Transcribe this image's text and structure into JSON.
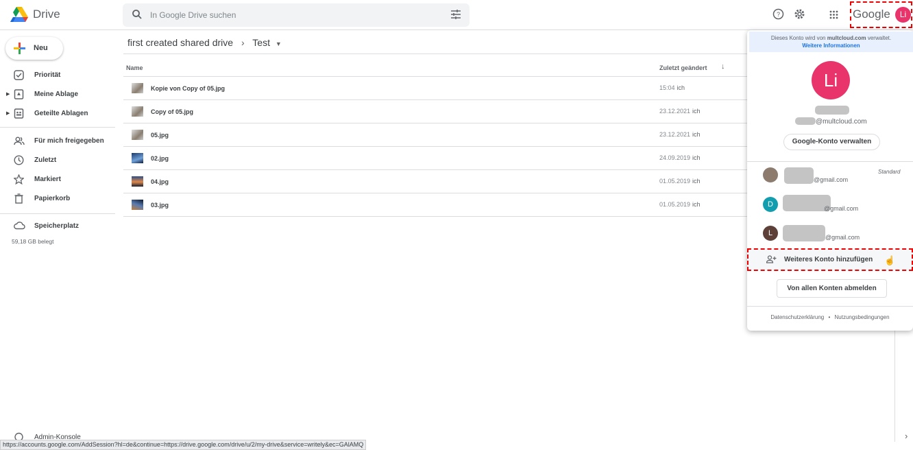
{
  "header": {
    "app_name": "Drive",
    "search_placeholder": "In Google Drive suchen",
    "google_logo": "Google",
    "avatar_initials": "Li"
  },
  "sidebar": {
    "new_label": "Neu",
    "items": [
      {
        "label": "Priorität",
        "icon": "check-box-icon"
      },
      {
        "label": "Meine Ablage",
        "icon": "my-drive-icon"
      },
      {
        "label": "Geteilte Ablagen",
        "icon": "shared-drives-icon"
      },
      {
        "label": "Für mich freigegeben",
        "icon": "people-icon"
      },
      {
        "label": "Zuletzt",
        "icon": "clock-icon"
      },
      {
        "label": "Markiert",
        "icon": "star-icon"
      },
      {
        "label": "Papierkorb",
        "icon": "trash-icon"
      },
      {
        "label": "Speicherplatz",
        "icon": "cloud-icon"
      }
    ],
    "storage_used": "59,18 GB belegt",
    "admin_label": "Admin-Konsole"
  },
  "breadcrumb": {
    "parent": "first created shared drive",
    "current": "Test"
  },
  "table": {
    "col_name": "Name",
    "col_modified": "Zuletzt geändert",
    "rows": [
      {
        "name": "Kopie von Copy of 05.jpg",
        "date": "15:04",
        "by": "ich"
      },
      {
        "name": "Copy of 05.jpg",
        "date": "23.12.2021",
        "by": "ich"
      },
      {
        "name": "05.jpg",
        "date": "23.12.2021",
        "by": "ich"
      },
      {
        "name": "02.jpg",
        "date": "24.09.2019",
        "by": "ich"
      },
      {
        "name": "04.jpg",
        "date": "01.05.2019",
        "by": "ich"
      },
      {
        "name": "03.jpg",
        "date": "01.05.2019",
        "by": "ich"
      }
    ]
  },
  "account_panel": {
    "managed_prefix": "Dieses Konto wird von",
    "managed_domain": "multcloud.com",
    "managed_suffix": "verwaltet.",
    "more_info": "Weitere Informationen",
    "avatar": "Li",
    "email_domain": "@multcloud.com",
    "manage_button": "Google-Konto verwalten",
    "accounts": [
      {
        "initial": "",
        "email": "@gmail.com",
        "badge": "Standard",
        "color": "#8d7b6e"
      },
      {
        "initial": "D",
        "email": "@gmail.com",
        "color": "#129eaf"
      },
      {
        "initial": "L",
        "email": "@gmail.com",
        "color": "#5d4037"
      }
    ],
    "add_account": "Weiteres Konto hinzufügen",
    "sign_out_all": "Von allen Konten abmelden",
    "privacy": "Datenschutzerklärung",
    "dot": "•",
    "terms": "Nutzungsbedingungen"
  },
  "status_url": "https://accounts.google.com/AddSession?hl=de&continue=https://drive.google.com/drive/u/2/my-drive&service=writely&ec=GAlAMQ"
}
